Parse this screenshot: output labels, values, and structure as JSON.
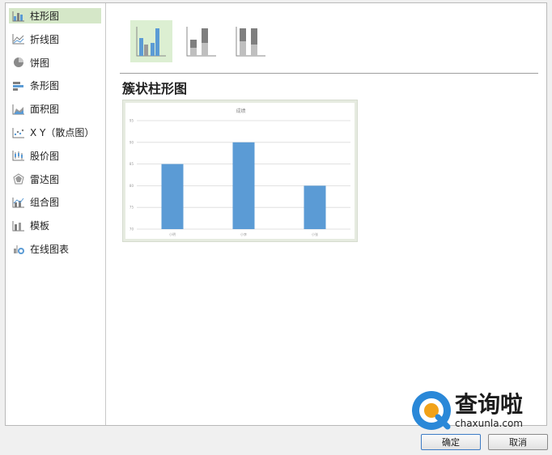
{
  "sidebar": {
    "items": [
      {
        "label": "柱形图",
        "icon": "column-chart-icon",
        "active": true
      },
      {
        "label": "折线图",
        "icon": "line-chart-icon"
      },
      {
        "label": "饼图",
        "icon": "pie-chart-icon"
      },
      {
        "label": "条形图",
        "icon": "bar-chart-icon"
      },
      {
        "label": "面积图",
        "icon": "area-chart-icon"
      },
      {
        "label": "X Y（散点图）",
        "icon": "scatter-chart-icon"
      },
      {
        "label": "股价图",
        "icon": "stock-chart-icon"
      },
      {
        "label": "雷达图",
        "icon": "radar-chart-icon"
      },
      {
        "label": "组合图",
        "icon": "combo-chart-icon"
      },
      {
        "label": "模板",
        "icon": "template-icon"
      },
      {
        "label": "在线图表",
        "icon": "online-chart-icon"
      }
    ]
  },
  "subtypes": [
    {
      "icon": "clustered-column-icon",
      "active": true
    },
    {
      "icon": "stacked-column-icon"
    },
    {
      "icon": "percent-stacked-column-icon"
    }
  ],
  "main": {
    "chart_type_title": "簇状柱形图"
  },
  "chart_data": {
    "type": "bar",
    "title": "成绩",
    "categories": [
      "小明",
      "小李",
      "小张"
    ],
    "values": [
      85,
      90,
      80
    ],
    "ylim": [
      70,
      95
    ],
    "yticks": [
      70,
      75,
      80,
      85,
      90,
      95
    ],
    "grid": true,
    "colors": {
      "bar": "#5b9bd5",
      "grid": "#d9d9d9"
    }
  },
  "buttons": {
    "ok": "确定",
    "cancel": "取消"
  },
  "watermark": {
    "text": "查询啦",
    "url": "chaxunla.com"
  },
  "colors": {
    "selected": "#d5e7c8",
    "accent": "#3d7bc4"
  }
}
